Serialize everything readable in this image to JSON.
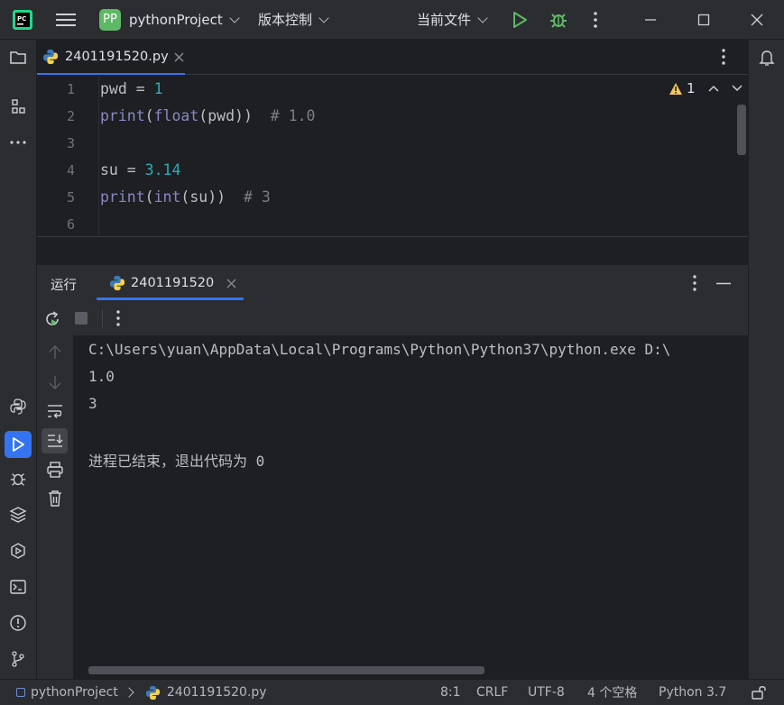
{
  "titlebar": {
    "project_badge": "PP",
    "project_name": "pythonProject",
    "vcs_label": "版本控制",
    "run_config": "当前文件"
  },
  "editor": {
    "tab_filename": "2401191520.py",
    "warning_count": "1",
    "lines": [
      {
        "n": "1",
        "parts": [
          {
            "t": "pwd = ",
            "c": ""
          },
          {
            "t": "1",
            "c": "num"
          }
        ]
      },
      {
        "n": "2",
        "parts": [
          {
            "t": "print",
            "c": "bi"
          },
          {
            "t": "(",
            "c": ""
          },
          {
            "t": "float",
            "c": "bi"
          },
          {
            "t": "(pwd))  ",
            "c": ""
          },
          {
            "t": "# 1.0",
            "c": "cm"
          }
        ]
      },
      {
        "n": "3",
        "parts": []
      },
      {
        "n": "4",
        "parts": [
          {
            "t": "su = ",
            "c": ""
          },
          {
            "t": "3.14",
            "c": "num"
          }
        ]
      },
      {
        "n": "5",
        "parts": [
          {
            "t": "print",
            "c": "bi"
          },
          {
            "t": "(",
            "c": ""
          },
          {
            "t": "int",
            "c": "bi"
          },
          {
            "t": "(su))  ",
            "c": ""
          },
          {
            "t": "# 3",
            "c": "cm"
          }
        ]
      },
      {
        "n": "6",
        "parts": []
      }
    ]
  },
  "run_panel": {
    "title": "运行",
    "tab_label": "2401191520",
    "console_lines": [
      "C:\\Users\\yuan\\AppData\\Local\\Programs\\Python\\Python37\\python.exe D:\\",
      "1.0",
      "3",
      "",
      "进程已结束，退出代码为 0"
    ]
  },
  "statusbar": {
    "project": "pythonProject",
    "file": "2401191520.py",
    "position": "8:1",
    "line_sep": "CRLF",
    "encoding": "UTF-8",
    "indent": "4 个空格",
    "interpreter": "Python 3.7"
  },
  "colors": {
    "accent": "#3574f0",
    "run_green": "#5fb865",
    "warning": "#f2c55c"
  }
}
